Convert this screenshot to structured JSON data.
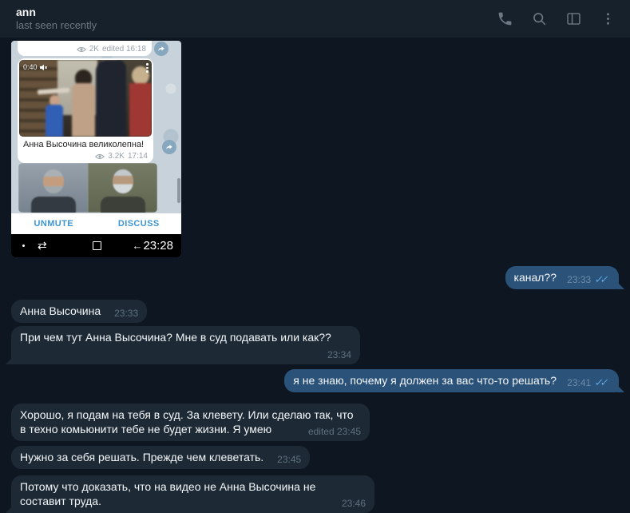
{
  "colors": {
    "background": "#0e1621",
    "header": "#17212b",
    "incoming_bubble": "#1d2a36",
    "outgoing_bubble": "#2b5278",
    "check_blue": "#5ca8e8",
    "muted_text": "#6c7883",
    "screenshot_link_blue": "#3d96d2"
  },
  "header": {
    "title": "ann",
    "status": "last seen recently",
    "icons": [
      "phone-icon",
      "search-icon",
      "sidebar-icon",
      "menu-icon"
    ]
  },
  "attachment": {
    "partial_message": {
      "views": "2K",
      "meta": "edited 16:18"
    },
    "video_message": {
      "duration": "0:40",
      "caption": "Анна Высочина великолепна!",
      "views": "3.2K",
      "time": "17:14"
    },
    "action_buttons": {
      "unmute": "UNMUTE",
      "discuss": "DISCUSS"
    },
    "phone_navbar": {
      "time": "23:28"
    }
  },
  "glyphs": {
    "double_check": "✓✓",
    "recents": "⇄",
    "back": "←"
  },
  "messages": [
    {
      "direction": "out",
      "text": "канал??",
      "time_label": "23:33",
      "read": true
    },
    {
      "direction": "in",
      "text": "Анна Высочина",
      "time_label": "23:33"
    },
    {
      "direction": "in",
      "text": "При чем тут Анна Высочина? Мне в суд подавать или как??",
      "time_label": "23:34"
    },
    {
      "direction": "out",
      "text": "я не знаю, почему я должен за вас что-то решать?",
      "time_label": "23:41",
      "read": true
    },
    {
      "direction": "in",
      "text": "Хорошо, я подам на тебя в суд. За клевету. Или сделаю так, что\nв техно комьюнити тебе не будет жизни. Я умею",
      "time_label": "edited 23:45"
    },
    {
      "direction": "in",
      "text": "Нужно за себя решать. Прежде чем клеветать.",
      "time_label": "23:45"
    },
    {
      "direction": "in",
      "text": "Потому что доказать, что на видео не Анна Высочина не\nсоставит труда.",
      "time_label": "23:46"
    }
  ]
}
